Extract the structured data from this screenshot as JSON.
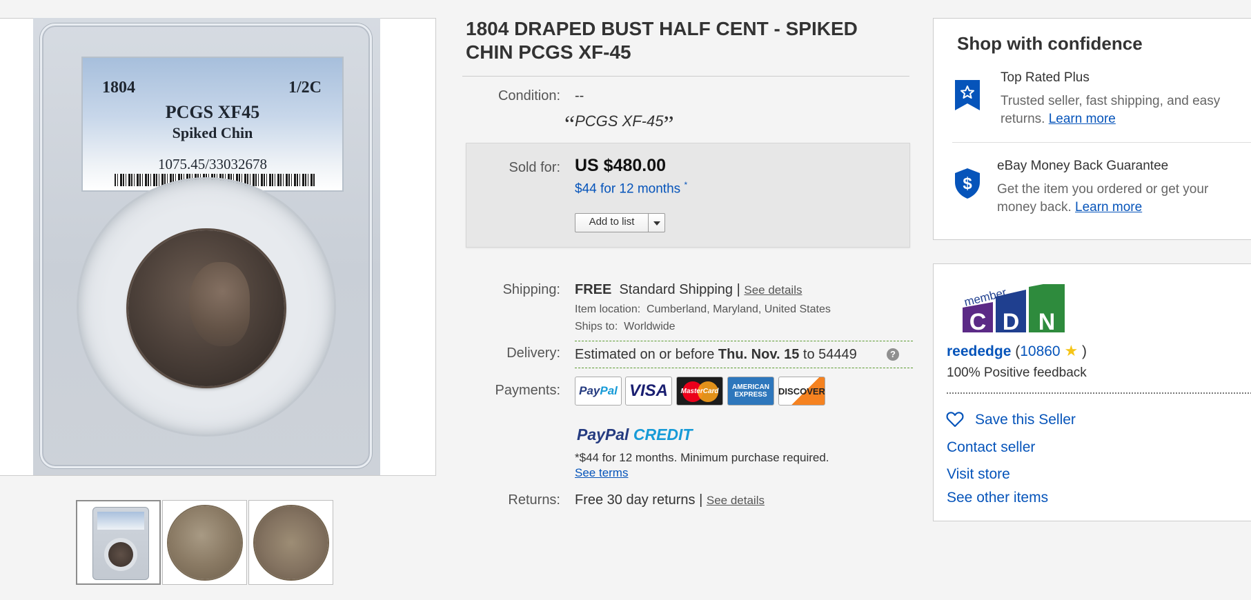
{
  "image_viewer": {
    "slab_label": {
      "year": "1804",
      "denomination": "1/2C",
      "grade": "PCGS XF45",
      "variety": "Spiked Chin",
      "cert_number": "1075.45/33032678"
    },
    "thumbnails": [
      "slab-photo",
      "obverse-photo",
      "reverse-photo"
    ]
  },
  "item": {
    "title": "1804 DRAPED BUST HALF CENT - SPIKED CHIN PCGS XF-45",
    "condition_label": "Condition:",
    "condition_value": "--",
    "condition_quote": "PCGS XF-45"
  },
  "sale": {
    "sold_for_label": "Sold for:",
    "price": "US $480.00",
    "finance_text": "$44 for 12 months",
    "finance_marker": "*",
    "add_to_list_label": "Add to list"
  },
  "shipping": {
    "label": "Shipping:",
    "free": "FREE",
    "method": "Standard Shipping |",
    "see_details": "See details",
    "location_label": "Item location:",
    "location": "Cumberland, Maryland, United States",
    "ships_to_label": "Ships to:",
    "ships_to": "Worldwide"
  },
  "delivery": {
    "label": "Delivery:",
    "prefix": "Estimated on or before",
    "date": "Thu. Nov. 15",
    "to": "to 54449",
    "help": "?"
  },
  "payments": {
    "label": "Payments:",
    "cards": {
      "paypal_a": "Pay",
      "paypal_b": "Pal",
      "visa": "VISA",
      "mastercard": "MasterCard",
      "amex_a": "AMERICAN",
      "amex_b": "EXPRESS",
      "discover": "DISCOVER"
    },
    "credit_a": "PayPal",
    "credit_b": "CREDIT",
    "credit_note": "*$44 for 12 months. Minimum purchase required.",
    "see_terms": "See terms"
  },
  "returns": {
    "label": "Returns:",
    "text": "Free 30 day returns |",
    "see_details": "See details"
  },
  "confidence": {
    "heading": "Shop with confidence",
    "items": [
      {
        "title": "Top Rated Plus",
        "desc": "Trusted seller, fast shipping, and easy returns.",
        "link": "Learn more"
      },
      {
        "title": "eBay Money Back Guarantee",
        "desc": "Get the item you ordered or get your money back.",
        "link": "Learn more"
      }
    ]
  },
  "seller": {
    "logo_small": "member",
    "logo_letters": [
      "C",
      "D",
      "N"
    ],
    "name": "reededge",
    "score": "10860",
    "open_paren": "(",
    "close_paren": ")",
    "feedback": "100% Positive feedback",
    "save": "Save this Seller",
    "contact": "Contact seller",
    "visit": "Visit store",
    "other": "See other items"
  },
  "colors": {
    "link_blue": "#0654ba",
    "badge_blue": "#0654ba",
    "sold_box_bg": "#e7e7e7",
    "star": "#f5c518"
  }
}
